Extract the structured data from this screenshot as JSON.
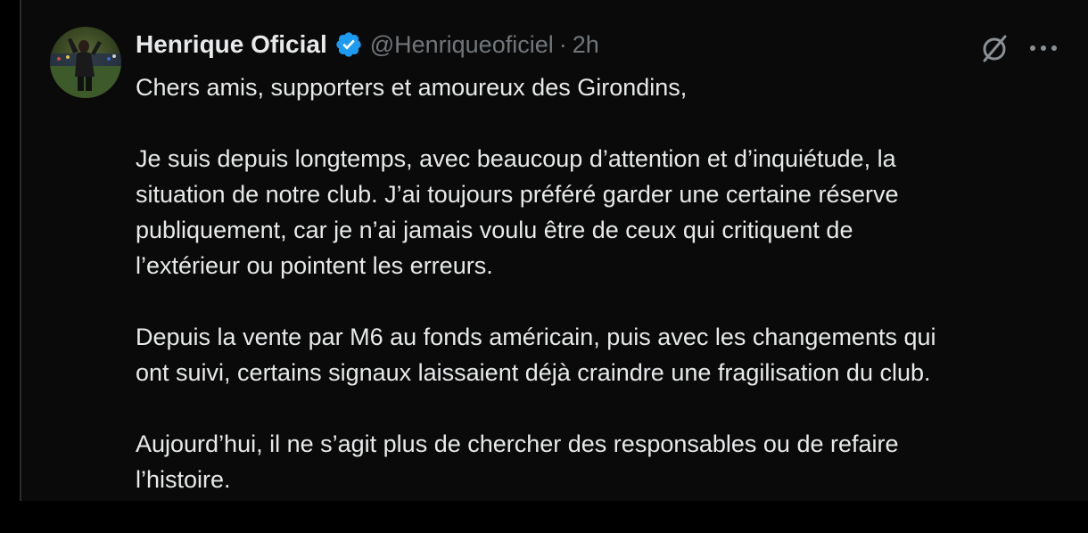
{
  "tweet": {
    "author": {
      "display_name": "Henrique Oficial",
      "handle": "@Henriqueoficiel",
      "separator": "·",
      "timestamp": "2h",
      "verified_color": "#1d9bf0"
    },
    "paragraphs": [
      {
        "lines": [
          "Chers amis, supporters et amoureux des Girondins,"
        ]
      },
      {
        "lines": [
          "Je suis depuis longtemps, avec beaucoup d’attention et d’inquiétude, la",
          "situation de notre club. J’ai toujours préféré garder une certaine réserve",
          "publiquement, car je n’ai jamais voulu être de ceux qui critiquent de",
          "l’extérieur ou pointent les erreurs."
        ]
      },
      {
        "lines": [
          "Depuis la vente par M6 au fonds américain, puis avec les changements qui",
          "ont suivi, certains signaux laissaient déjà craindre une fragilisation du club."
        ]
      },
      {
        "lines": [
          "Aujourd’hui, il ne s’agit plus de chercher des responsables ou de refaire",
          "l’histoire."
        ]
      }
    ],
    "icons": {
      "grok": "grok-slash-icon",
      "more": "more-dots-icon"
    }
  },
  "colors": {
    "background": "#000000",
    "text": "#e7e9ea",
    "secondary": "#71767b",
    "accent": "#1d9bf0"
  }
}
